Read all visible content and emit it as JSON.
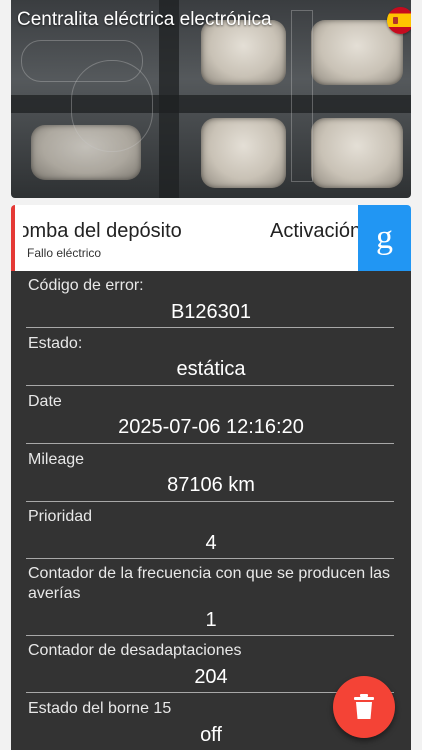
{
  "header": {
    "title": "Centralita eléctrica electrónica",
    "flag_icon": "spain-flag-icon"
  },
  "error": {
    "name": "Bomba del depósito",
    "name_next": "Activación",
    "description": "Fallo eléctrico",
    "accent_color": "#e53935"
  },
  "google_button": {
    "label": "g",
    "color": "#2196f3"
  },
  "details": [
    {
      "label": "Código de error:",
      "value": "B126301"
    },
    {
      "label": "Estado:",
      "value": "estática"
    },
    {
      "label": "Date",
      "value": "2025-07-06 12:16:20"
    },
    {
      "label": "Mileage",
      "value": "87106 km"
    },
    {
      "label": "Prioridad",
      "value": "4"
    },
    {
      "label": "Contador de la frecuencia con que se producen las averías",
      "value": "1"
    },
    {
      "label": "Contador de desadaptaciones",
      "value": "204"
    },
    {
      "label": "Estado del borne 15",
      "value": "off"
    }
  ],
  "fab": {
    "icon": "trash-icon",
    "color": "#f44336"
  }
}
